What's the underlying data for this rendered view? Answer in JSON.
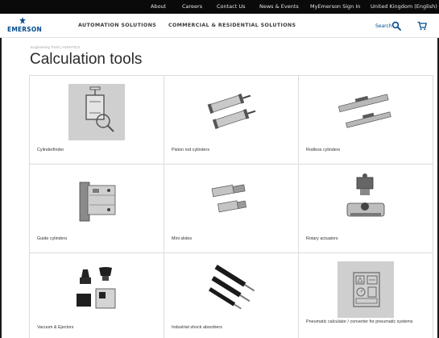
{
  "utility_nav": [
    {
      "label": "About"
    },
    {
      "label": "Careers"
    },
    {
      "label": "Contact Us"
    },
    {
      "label": "News & Events"
    },
    {
      "label": "MyEmerson Sign In"
    },
    {
      "label": "United Kingdom (English)"
    }
  ],
  "brand": {
    "name": "EMERSON",
    "color": "#004b8d"
  },
  "main_nav": {
    "automation": "AUTOMATION SOLUTIONS",
    "commercial": "COMMERCIAL & RESIDENTIAL SOLUTIONS",
    "search_label": "Search",
    "search_icon": "search-icon",
    "cart_icon": "cart-icon"
  },
  "page": {
    "breadcrumb": "Engineering Tools | AVENTICS",
    "title": "Calculation tools"
  },
  "tools": [
    {
      "label": "Cylinderfinder",
      "icon": "cylinder-finder-icon"
    },
    {
      "label": "Piston rod cylinders",
      "icon": "piston-rod-cylinders-image"
    },
    {
      "label": "Rodless cylinders",
      "icon": "rodless-cylinders-image"
    },
    {
      "label": "Guide cylinders",
      "icon": "guide-cylinders-image"
    },
    {
      "label": "Mini slides",
      "icon": "mini-slides-image"
    },
    {
      "label": "Rotary actuators",
      "icon": "rotary-actuators-image"
    },
    {
      "label": "Vacuum & Ejectors",
      "icon": "vacuum-ejectors-image"
    },
    {
      "label": "Industrial shock absorbers",
      "icon": "shock-absorbers-image"
    },
    {
      "label": "Pneumatic calculator / converter for pneumatic systems",
      "icon": "pneumatic-calculator-icon"
    }
  ]
}
